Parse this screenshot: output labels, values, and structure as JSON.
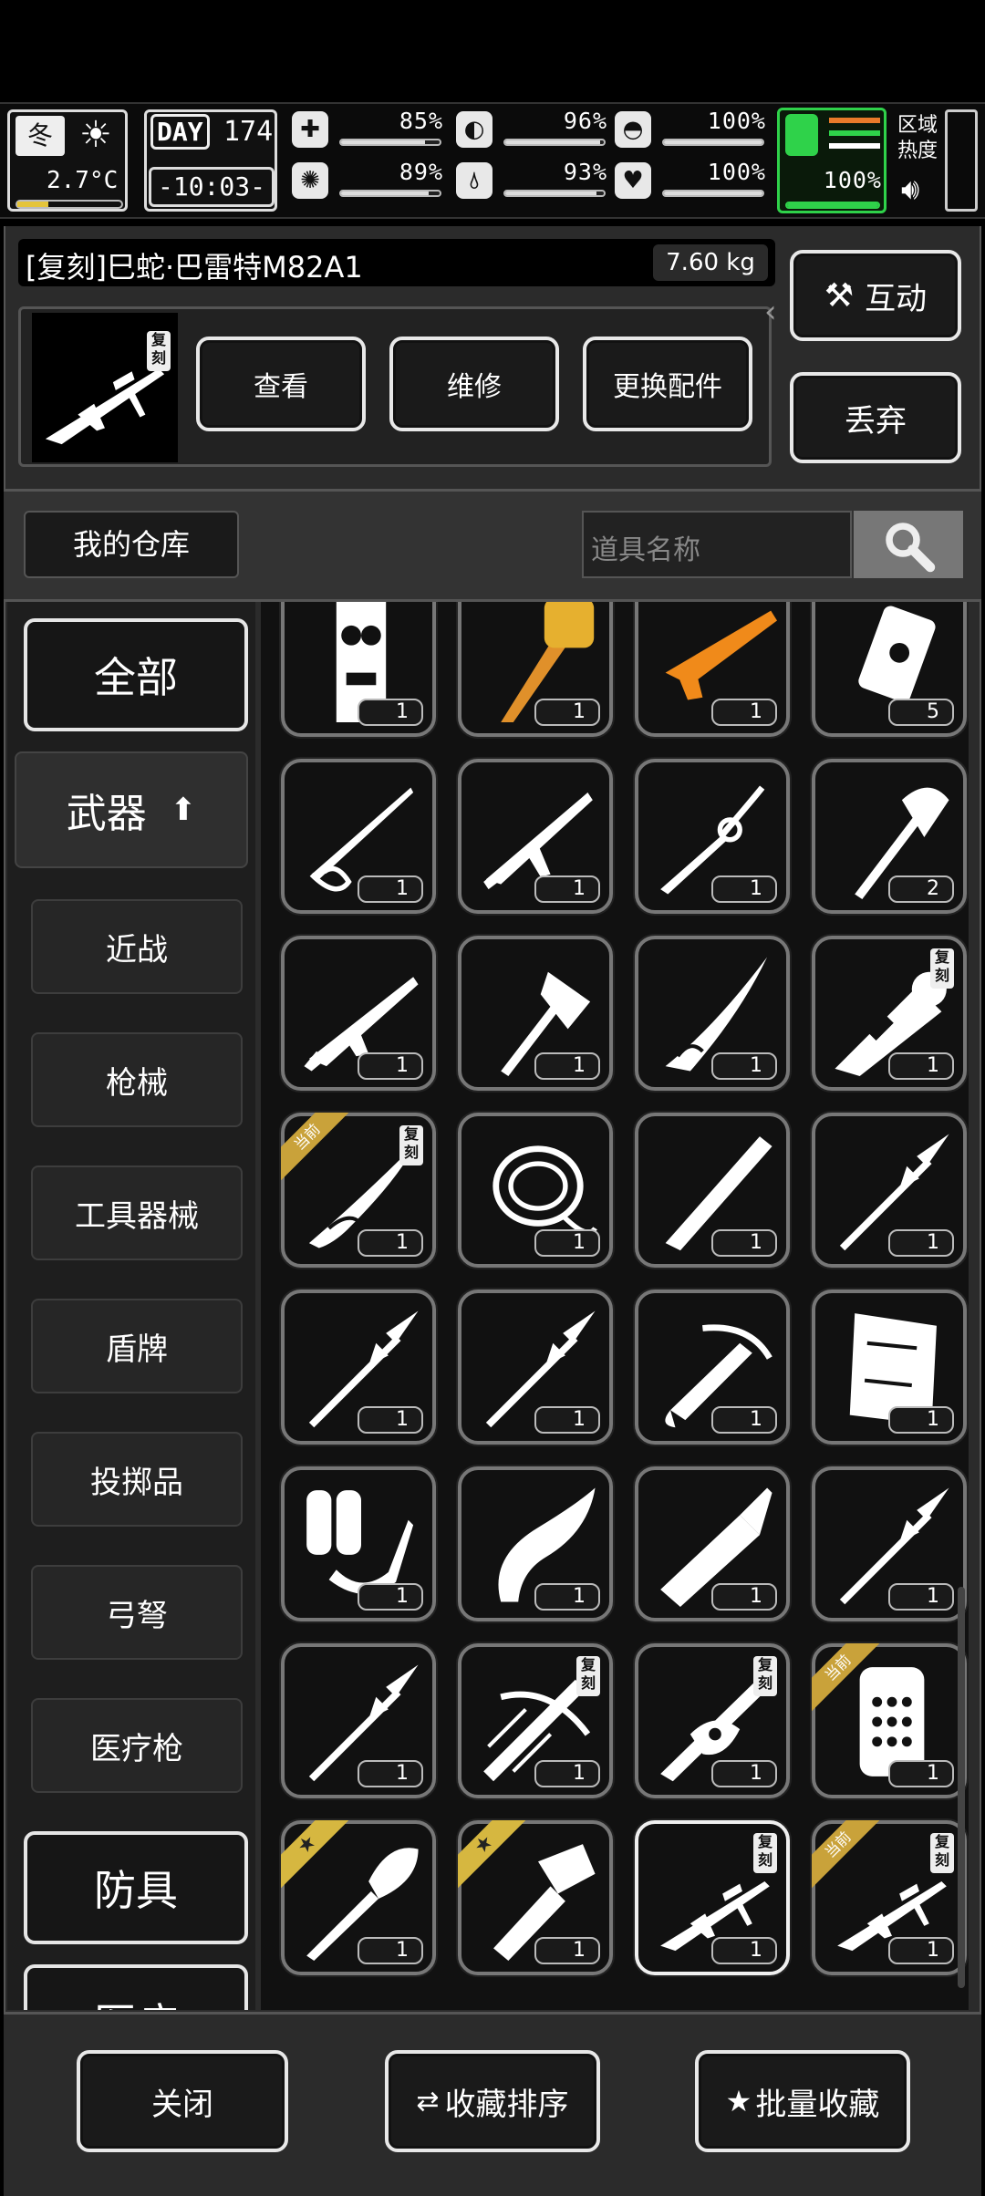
{
  "hud": {
    "season": "冬",
    "temperature": "2.7°C",
    "day_label": "DAY",
    "day_number": "174",
    "clock": "-10:03-",
    "stats": [
      {
        "name": "health",
        "icon": "medkit-icon",
        "value": "85%",
        "fill": 0.85
      },
      {
        "name": "hunger",
        "icon": "stomach-icon",
        "value": "96%",
        "fill": 0.96
      },
      {
        "name": "armor",
        "icon": "helmet-icon",
        "value": "100%",
        "fill": 1.0
      },
      {
        "name": "sanity",
        "icon": "brain-icon",
        "value": "89%",
        "fill": 0.89
      },
      {
        "name": "thirst",
        "icon": "water-drop-icon",
        "value": "93%",
        "fill": 0.93
      },
      {
        "name": "mood",
        "icon": "heart-icon",
        "value": "100%",
        "fill": 1.0
      }
    ],
    "stamina": {
      "value": "100%",
      "fill": 1.0,
      "color": "#2fd24a"
    },
    "zone_heat": "区域热度",
    "zone_heat_line1": "区域",
    "zone_heat_line2": "热度"
  },
  "selected_item": {
    "name": "[复刻]巳蛇·巴雷特M82A1",
    "weight": "7.60 kg",
    "badge": "复刻",
    "actions": {
      "view": "查看",
      "repair": "维修",
      "swap_parts": "更换配件"
    },
    "interact": "互动",
    "discard": "丢弃"
  },
  "storage": {
    "title": "我的仓库",
    "search_placeholder": "道具名称"
  },
  "categories": [
    {
      "label": "全部",
      "type": "main"
    },
    {
      "label": "武器",
      "type": "main-active"
    },
    {
      "label": "近战",
      "type": "sub"
    },
    {
      "label": "枪械",
      "type": "sub"
    },
    {
      "label": "工具器械",
      "type": "sub"
    },
    {
      "label": "盾牌",
      "type": "sub"
    },
    {
      "label": "投掷品",
      "type": "sub"
    },
    {
      "label": "弓弩",
      "type": "sub"
    },
    {
      "label": "医疗枪",
      "type": "sub"
    },
    {
      "label": "防具",
      "type": "main"
    },
    {
      "label": "医疗",
      "type": "main"
    }
  ],
  "items": [
    {
      "icon": "tiki-mask-icon",
      "count": "1"
    },
    {
      "icon": "golden-staff-icon",
      "count": "1"
    },
    {
      "icon": "orange-rifle-icon",
      "count": "1"
    },
    {
      "icon": "explosive-charge-icon",
      "count": "5"
    },
    {
      "icon": "whip-sword-icon",
      "count": "1"
    },
    {
      "icon": "ak-rifle-icon",
      "count": "1"
    },
    {
      "icon": "rapier-icon",
      "count": "1"
    },
    {
      "icon": "axe-icon",
      "count": "2"
    },
    {
      "icon": "assault-rifle-icon",
      "count": "1"
    },
    {
      "icon": "hatchet-icon",
      "count": "1"
    },
    {
      "icon": "serpent-blade-icon",
      "count": "1"
    },
    {
      "icon": "rocket-launcher-icon",
      "count": "1",
      "replica": "复刻"
    },
    {
      "icon": "serpent-sword-icon",
      "count": "1",
      "replica": "复刻",
      "ribbon": "当前"
    },
    {
      "icon": "rope-icon",
      "count": "1"
    },
    {
      "icon": "machete-icon",
      "count": "1"
    },
    {
      "icon": "spear-icon",
      "count": "1"
    },
    {
      "icon": "spear-icon",
      "count": "1"
    },
    {
      "icon": "spear-icon",
      "count": "1"
    },
    {
      "icon": "crossbow-icon",
      "count": "1"
    },
    {
      "icon": "wooden-board-icon",
      "count": "1"
    },
    {
      "icon": "flamethrower-icon",
      "count": "1"
    },
    {
      "icon": "kukri-icon",
      "count": "1"
    },
    {
      "icon": "broadsword-icon",
      "count": "1"
    },
    {
      "icon": "spear-icon",
      "count": "1"
    },
    {
      "icon": "spear-icon",
      "count": "1"
    },
    {
      "icon": "compound-crossbow-icon",
      "count": "1",
      "replica": "复刻"
    },
    {
      "icon": "serpent-rifle-icon",
      "count": "1",
      "replica": "复刻"
    },
    {
      "icon": "riot-shield-icon",
      "count": "1",
      "ribbon": "当前"
    },
    {
      "icon": "shovel-icon",
      "count": "1",
      "star": true
    },
    {
      "icon": "hammer-knife-icon",
      "count": "1",
      "star": true
    },
    {
      "icon": "sniper-rifle-icon",
      "count": "1",
      "replica": "复刻",
      "selected": true
    },
    {
      "icon": "sniper-rifle-icon",
      "count": "1",
      "replica": "复刻",
      "ribbon": "当前"
    }
  ],
  "footer": {
    "close": "关闭",
    "sort_favorites": "收藏排序",
    "bulk_favorite": "批量收藏"
  },
  "colors": {
    "ribbon": "#c9a23a",
    "star_ribbon": "#d6b740",
    "stamina": "#2fd24a"
  }
}
